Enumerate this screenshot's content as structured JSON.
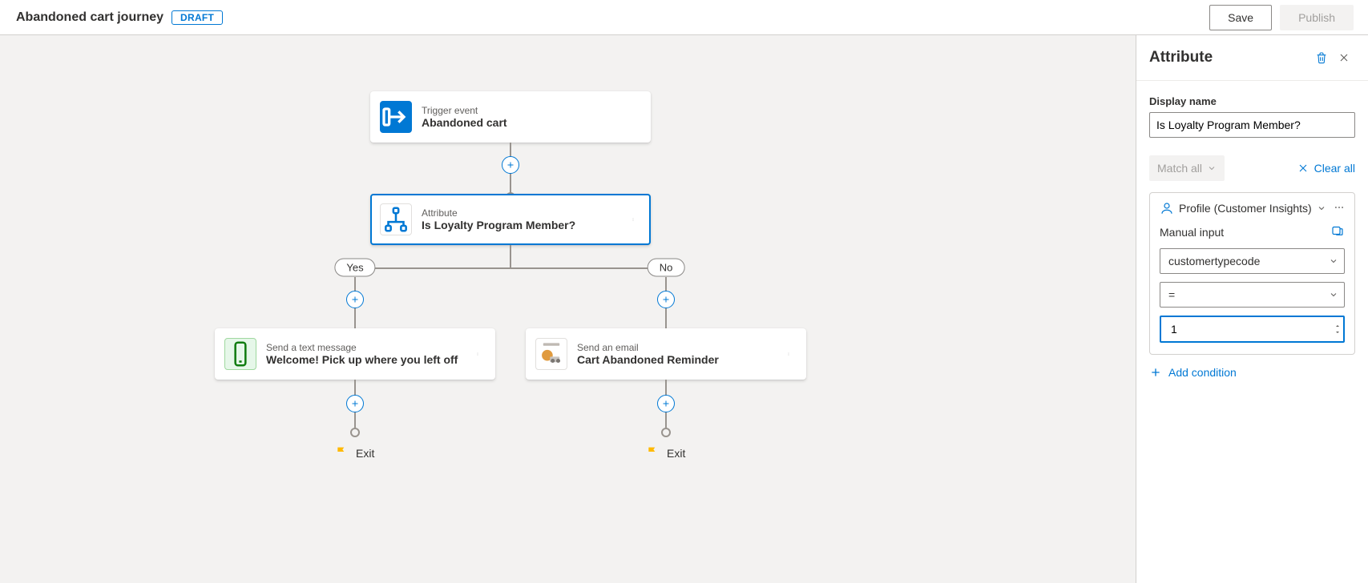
{
  "header": {
    "title": "Abandoned cart journey",
    "status": "DRAFT",
    "save_label": "Save",
    "publish_label": "Publish"
  },
  "panel": {
    "title": "Attribute",
    "display_name_label": "Display name",
    "display_name_value": "Is Loyalty Program Member?",
    "match_all_label": "Match all",
    "clear_all_label": "Clear all",
    "condition": {
      "source_label": "Profile (Customer Insights)",
      "manual_input_label": "Manual input",
      "attribute_value": "customertypecode",
      "operator_value": "=",
      "number_value": "1"
    },
    "add_condition_label": "Add condition"
  },
  "canvas": {
    "trigger": {
      "eyebrow": "Trigger event",
      "title": "Abandoned cart"
    },
    "attribute": {
      "eyebrow": "Attribute",
      "title": "Is Loyalty Program Member?"
    },
    "sms": {
      "eyebrow": "Send a text message",
      "title": "Welcome! Pick up where you left off"
    },
    "email": {
      "eyebrow": "Send an email",
      "title": "Cart Abandoned Reminder"
    },
    "branch": {
      "yes": "Yes",
      "no": "No"
    },
    "exit_label": "Exit"
  }
}
